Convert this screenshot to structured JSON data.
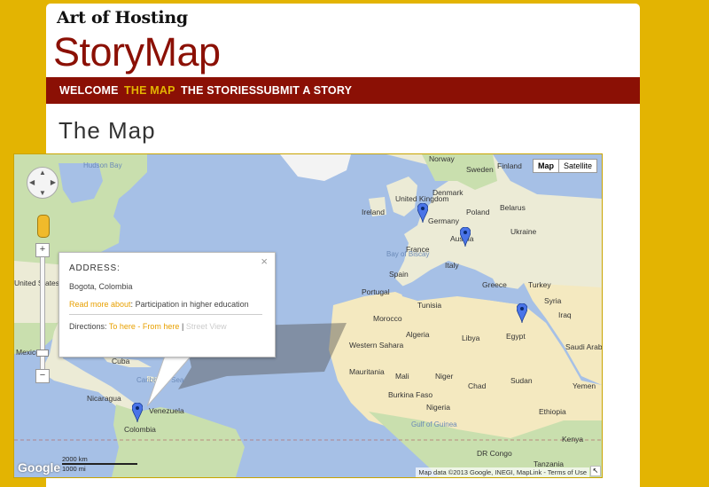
{
  "brand": {
    "top": "Art of Hosting",
    "main": "StoryMap"
  },
  "nav": {
    "items": [
      {
        "label": "WELCOME",
        "active": false
      },
      {
        "label": "THE MAP",
        "active": true
      },
      {
        "label": "THE STORIES",
        "active": false
      },
      {
        "label": "SUBMIT A STORY",
        "active": false
      }
    ]
  },
  "page": {
    "title": "The Map"
  },
  "map": {
    "type_buttons": {
      "map": "Map",
      "satellite": "Satellite"
    },
    "zoom": {
      "in": "+",
      "out": "−"
    },
    "labels": {
      "norway": "Norway",
      "sweden": "Sweden",
      "finland": "Finland",
      "hudson_bay": "Hudson Bay",
      "united_kingdom": "United Kingdom",
      "denmark": "Denmark",
      "ireland": "Ireland",
      "belarus": "Belarus",
      "poland": "Poland",
      "germany": "Germany",
      "ukraine": "Ukraine",
      "austria": "Austria",
      "france": "France",
      "bay_of_biscay": "Bay of Biscay",
      "italy": "Italy",
      "united_states": "United States",
      "spain": "Spain",
      "portugal": "Portugal",
      "greece": "Greece",
      "turkey": "Turkey",
      "syria": "Syria",
      "iraq": "Iraq",
      "tunisia": "Tunisia",
      "morocco": "Morocco",
      "algeria": "Algeria",
      "libya": "Libya",
      "egypt": "Egypt",
      "western_sahara": "Western Sahara",
      "saudi_arabia": "Saudi Arabia",
      "mexico": "Mexico",
      "cuba": "Cuba",
      "caribbean_sea": "Caribbean Sea",
      "mauritania": "Mauritania",
      "mali": "Mali",
      "niger": "Niger",
      "chad": "Chad",
      "sudan": "Sudan",
      "yemen": "Yemen",
      "nicaragua": "Nicaragua",
      "burkina_faso": "Burkina Faso",
      "nigeria": "Nigeria",
      "venezuela": "Venezuela",
      "ethiopia": "Ethiopia",
      "colombia": "Colombia",
      "gulf_of_guinea": "Gulf of Guinea",
      "kenya": "Kenya",
      "dr_congo": "DR Congo",
      "tanzania": "Tanzania"
    },
    "infowindow": {
      "heading": "ADDRESS:",
      "address": "Bogota, Colombia",
      "read_more": "Read more about",
      "colon": ":",
      "topic": "Participation in higher education",
      "directions_label": "Directions:",
      "to_here": "To here",
      "dash": "-",
      "from_here": "From here",
      "pipe": "|",
      "street_view": "Street View",
      "close": "×"
    },
    "footer": {
      "google": "Google",
      "scale_km": "2000 km",
      "scale_mi": "1000 mi",
      "attribution": "Map data ©2013 Google, INEGI, MapLink - Terms of Use"
    },
    "colors": {
      "water": "#a6c0e6",
      "land": "#ecebd6",
      "desert": "#f4e9c0",
      "forest": "#c9dfae",
      "marker": "#4a74e8"
    }
  }
}
